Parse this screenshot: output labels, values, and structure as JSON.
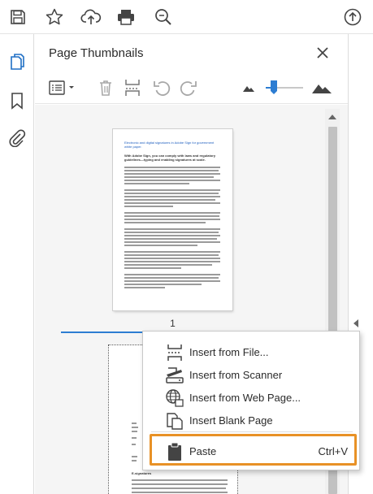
{
  "toolbar": {
    "icons": [
      "save-icon",
      "bookmark-star-icon",
      "upload-cloud-icon",
      "print-icon",
      "zoom-search-icon",
      "arrow-up-circle-icon"
    ]
  },
  "rail": {
    "items": [
      "page-thumbnails-icon",
      "bookmark-icon",
      "attachment-paperclip-icon"
    ]
  },
  "panel": {
    "title": "Page Thumbnails",
    "close_icon": "close-icon",
    "toolbar_icons": [
      "options-menu-icon",
      "delete-trash-icon",
      "insert-pages-icon",
      "rotate-ccw-icon",
      "rotate-cw-icon",
      "zoom-small-mountain-icon",
      "zoom-slider",
      "zoom-large-mountain-icon"
    ],
    "zoom_slider_value": 0.2
  },
  "thumbnails": {
    "page1": {
      "title": "Electronic and digital signatures in Adobe Sign for government white paper.",
      "subtitle": "With Adobe Sign, you can comply with laws and regulatory guidelines—typing and enabling signatures at scale.",
      "number": "1"
    },
    "page2": {
      "section": "E-signatures"
    }
  },
  "context_menu": {
    "items": [
      {
        "icon": "insert-file-icon",
        "label": "Insert from File..."
      },
      {
        "icon": "scanner-icon",
        "label": "Insert from Scanner"
      },
      {
        "icon": "web-globe-icon",
        "label": "Insert from Web Page..."
      },
      {
        "icon": "blank-page-icon",
        "label": "Insert Blank Page"
      },
      {
        "icon": "clipboard-paste-icon",
        "label": "Paste",
        "shortcut": "Ctrl+V"
      }
    ]
  },
  "colors": {
    "accent": "#2d7dd2",
    "highlight": "#e89126"
  }
}
